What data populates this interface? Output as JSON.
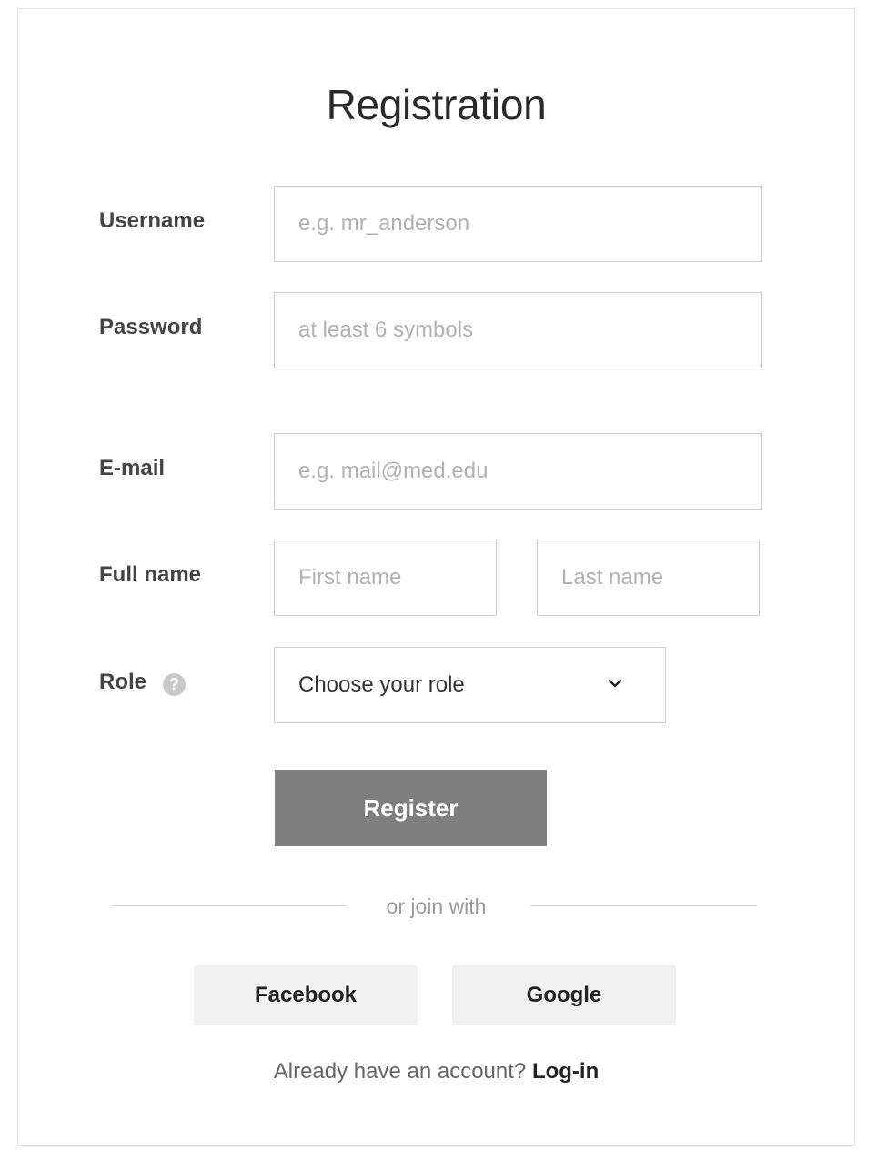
{
  "form": {
    "title": "Registration",
    "username": {
      "label": "Username",
      "placeholder": "e.g. mr_anderson"
    },
    "password": {
      "label": "Password",
      "placeholder": "at least 6 symbols"
    },
    "email": {
      "label": "E-mail",
      "placeholder": "e.g. mail@med.edu"
    },
    "full_name": {
      "label": "Full name",
      "first_placeholder": "First name",
      "last_placeholder": "Last name"
    },
    "role": {
      "label": "Role",
      "help_icon": "question-circle-icon",
      "help_glyph": "?",
      "selected": "Choose your role",
      "dropdown_icon": "chevron-down-icon"
    },
    "register_label": "Register"
  },
  "social": {
    "divider_text": "or join with",
    "facebook_label": "Facebook",
    "google_label": "Google"
  },
  "footer": {
    "prompt": "Already have an account?",
    "login_label": "Log-in"
  },
  "colors": {
    "primary_button": "#7f7f7f",
    "social_button_bg": "#f1f1f1",
    "border": "#cfcfcf"
  }
}
